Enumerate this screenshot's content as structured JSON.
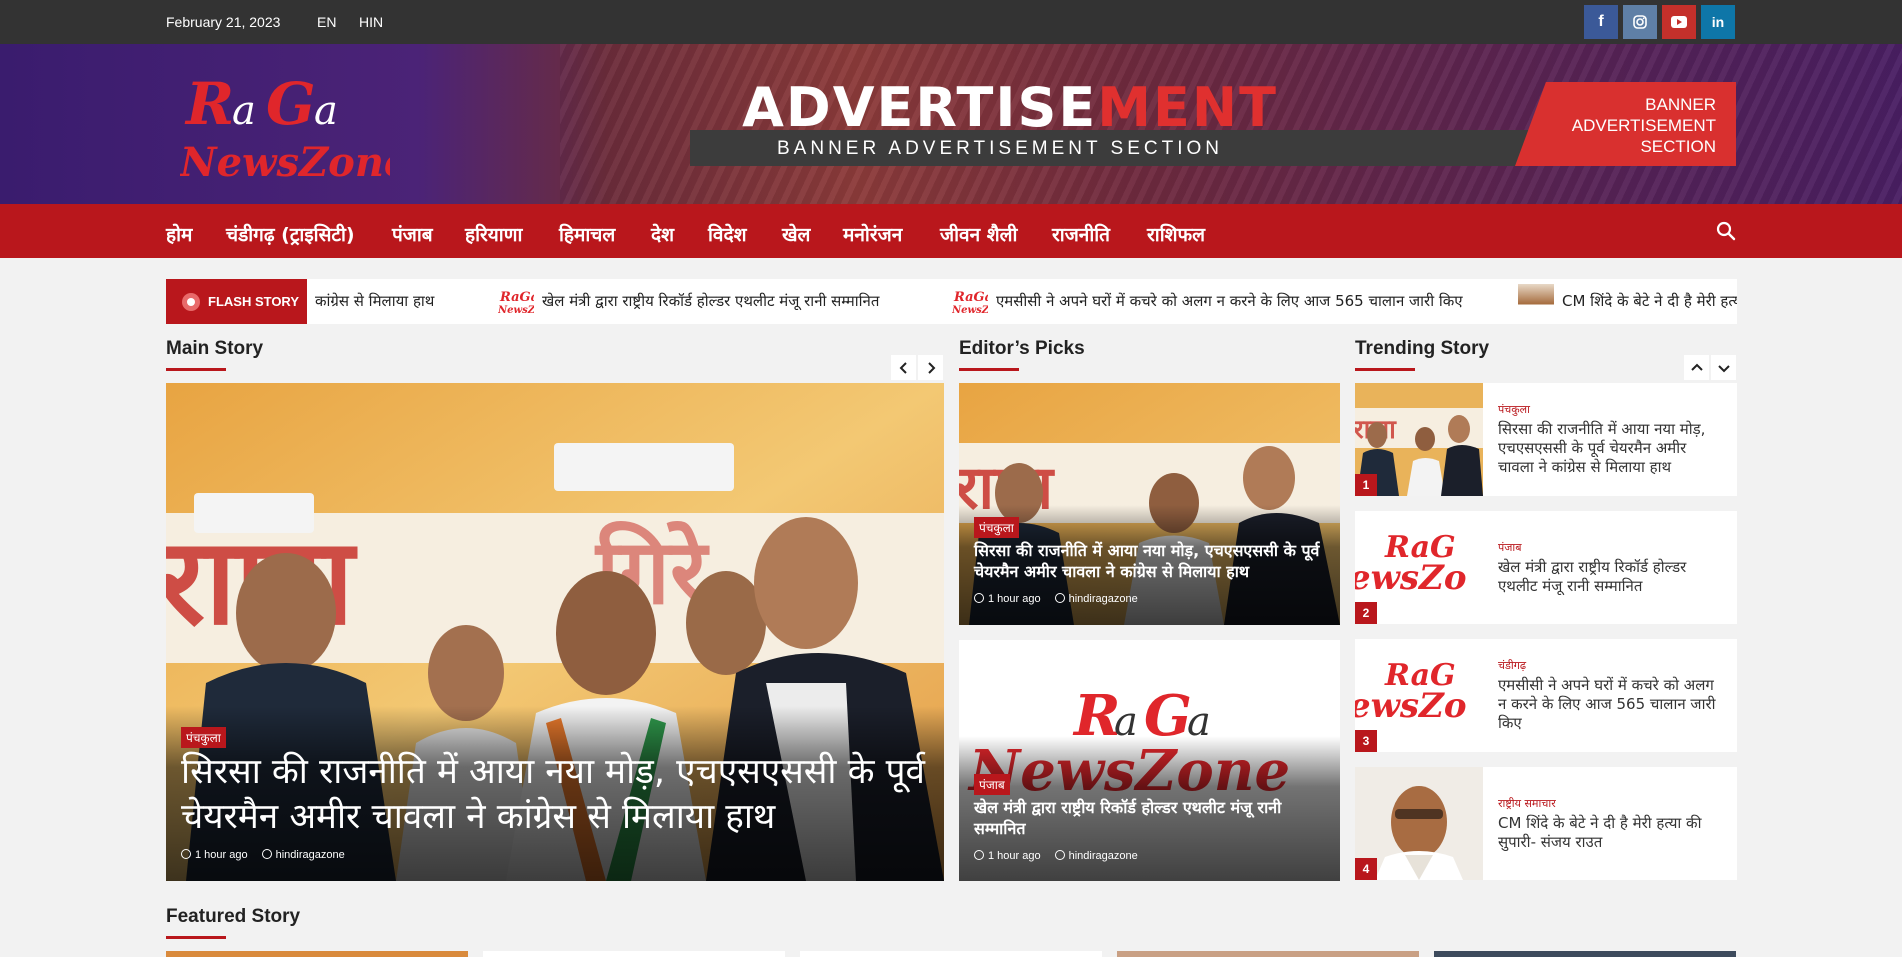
{
  "topbar": {
    "date": "February 21, 2023",
    "lang_en": "EN",
    "lang_hin": "HIN",
    "social": [
      "facebook-icon",
      "instagram-icon",
      "youtube-icon",
      "linkedin-icon"
    ]
  },
  "header": {
    "logo_line1": "RaGa",
    "logo_line2": "NewsZone",
    "ad_title_white": "ADVERTISE",
    "ad_title_red": "MENT",
    "ad_subtitle": "BANNER ADVERTISEMENT SECTION",
    "ad_badge": "BANNER ADVERTISEMENT SECTION"
  },
  "nav": {
    "items": [
      "होम",
      "चंडीगढ़ (ट्राइसिटी)",
      "पंजाब",
      "हरियाणा",
      "हिमाचल",
      "देश",
      "विदेश",
      "खेल",
      "मनोरंजन",
      "जीवन शैली",
      "राजनीति",
      "राशिफल"
    ]
  },
  "flash": {
    "label": "FLASH STORY",
    "items": [
      "कांग्रेस से मिलाया हाथ",
      "खेल मंत्री द्वारा राष्ट्रीय रिकॉर्ड होल्डर एथलीट मंजू रानी सम्मानित",
      "एमसीसी ने अपने घरों में कचरे को अलग न करने के लिए आज 565 चालान जारी किए",
      "CM शिंदे के बेटे ने दी है मेरी हत्या"
    ]
  },
  "sections": {
    "main": "Main Story",
    "editors": "Editor’s Picks",
    "trending": "Trending Story",
    "featured": "Featured Story"
  },
  "main_story": {
    "category": "पंचकुला",
    "title": "सिरसा की राजनीति में आया नया मोड़, एचएसएससी के पूर्व चेयरमैन अमीर चावला ने कांग्रेस से मिलाया हाथ",
    "time": "1 hour ago",
    "author": "hindiragazone"
  },
  "editors_picks": [
    {
      "category": "पंचकुला",
      "title": "सिरसा की राजनीति में आया नया मोड़, एचएसएससी के पूर्व चेयरमैन अमीर चावला ने कांग्रेस से मिलाया हाथ",
      "time": "1 hour ago",
      "author": "hindiragazone"
    },
    {
      "category": "पंजाब",
      "title": "खेल मंत्री द्वारा राष्ट्रीय रिकॉर्ड होल्डर एथलीट मंजू रानी सम्मानित",
      "time": "1 hour ago",
      "author": "hindiragazone"
    }
  ],
  "trending": [
    {
      "num": "1",
      "category": "पंचकुला",
      "title": "सिरसा की राजनीति में आया नया मोड़, एचएसएससी के पूर्व चेयरमैन अमीर चावला ने कांग्रेस से मिलाया हाथ"
    },
    {
      "num": "2",
      "category": "पंजाब",
      "title": "खेल मंत्री द्वारा राष्ट्रीय रिकॉर्ड होल्डर एथलीट मंजू रानी सम्मानित"
    },
    {
      "num": "3",
      "category": "चंडीगढ़",
      "title": "एमसीसी ने अपने घरों में कचरे को अलग न करने के लिए आज 565 चालान जारी किए"
    },
    {
      "num": "4",
      "category": "राष्ट्रीय समाचार",
      "title": "CM शिंदे के बेटे ने दी है मेरी हत्या की सुपारी- संजय राउत"
    }
  ],
  "colors": {
    "brand_red": "#b9171c",
    "topbar": "#333333"
  }
}
